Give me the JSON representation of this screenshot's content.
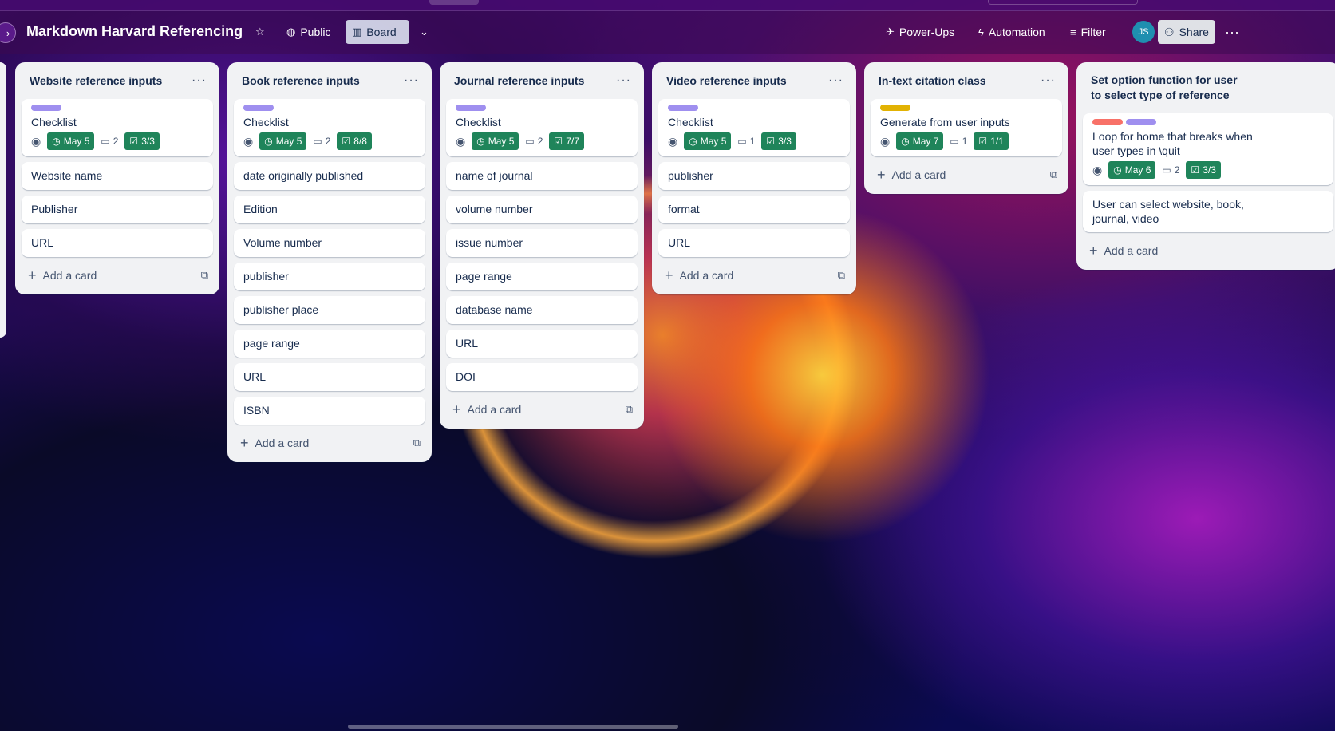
{
  "board": {
    "title": "Markdown Harvard Referencing",
    "visibility": "Public",
    "view": "Board",
    "power_ups": "Power-Ups",
    "automation": "Automation",
    "filter": "Filter",
    "avatar": "JS",
    "share": "Share",
    "more": "···"
  },
  "colors": {
    "purple_label": "#9f8fef",
    "yellow_label": "#e2b203",
    "red_label": "#f87168",
    "green_badge": "#1f845a"
  },
  "lists": [
    {
      "title": "Website reference inputs",
      "checklist": {
        "name": "Checklist",
        "label_colors": [
          "#9f8fef"
        ],
        "date": "May 5",
        "comments": "2",
        "progress": "3/3"
      },
      "cards": [
        "Website name",
        "Publisher",
        "URL"
      ],
      "add": "Add a card"
    },
    {
      "title": "Book reference inputs",
      "checklist": {
        "name": "Checklist",
        "label_colors": [
          "#9f8fef"
        ],
        "date": "May 5",
        "comments": "2",
        "progress": "8/8"
      },
      "cards": [
        "date originally published",
        "Edition",
        "Volume number",
        "publisher",
        "publisher place",
        "page range",
        "URL",
        "ISBN"
      ],
      "add": "Add a card"
    },
    {
      "title": "Journal reference inputs",
      "checklist": {
        "name": "Checklist",
        "label_colors": [
          "#9f8fef"
        ],
        "date": "May 5",
        "comments": "2",
        "progress": "7/7"
      },
      "cards": [
        "name of journal",
        "volume number",
        "issue number",
        "page range",
        "database name",
        "URL",
        "DOI"
      ],
      "add": "Add a card"
    },
    {
      "title": "Video reference inputs",
      "checklist": {
        "name": "Checklist",
        "label_colors": [
          "#9f8fef"
        ],
        "date": "May 5",
        "comments": "1",
        "progress": "3/3"
      },
      "cards": [
        "publisher",
        "format",
        "URL"
      ],
      "add": "Add a card"
    },
    {
      "title": "In-text citation class",
      "checklist": {
        "name": "Generate from user inputs",
        "label_colors": [
          "#e2b203"
        ],
        "date": "May 7",
        "comments": "1",
        "progress": "1/1"
      },
      "cards": [],
      "add": "Add a card"
    },
    {
      "title": "Set option function for user to select type of reference",
      "checklist": {
        "name": "Loop for home that breaks when user types in \\quit",
        "label_colors": [
          "#f87168",
          "#9f8fef"
        ],
        "date": "May 6",
        "comments": "2",
        "progress": "3/3"
      },
      "cards": [
        "User can select website, book, journal, video"
      ],
      "add": "Add a card"
    }
  ]
}
